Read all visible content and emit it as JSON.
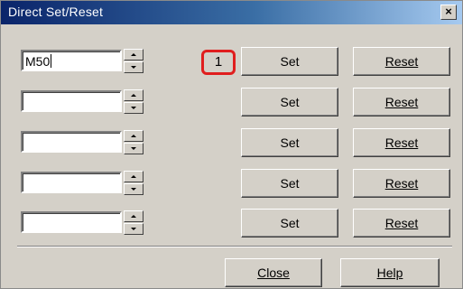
{
  "window": {
    "title": "Direct Set/Reset",
    "close_glyph": "×"
  },
  "rows": [
    {
      "device": "M50",
      "set_label": "Set",
      "reset_label": "Reset"
    },
    {
      "device": "",
      "set_label": "Set",
      "reset_label": "Reset"
    },
    {
      "device": "",
      "set_label": "Set",
      "reset_label": "Reset"
    },
    {
      "device": "",
      "set_label": "Set",
      "reset_label": "Reset"
    },
    {
      "device": "",
      "set_label": "Set",
      "reset_label": "Reset"
    }
  ],
  "current_value": "1",
  "highlight_color": "#e01e1e",
  "footer": {
    "close_label": "Close",
    "help_label": "Help"
  },
  "icons": {
    "spin_up": "spin-up-icon",
    "spin_down": "spin-down-icon"
  }
}
